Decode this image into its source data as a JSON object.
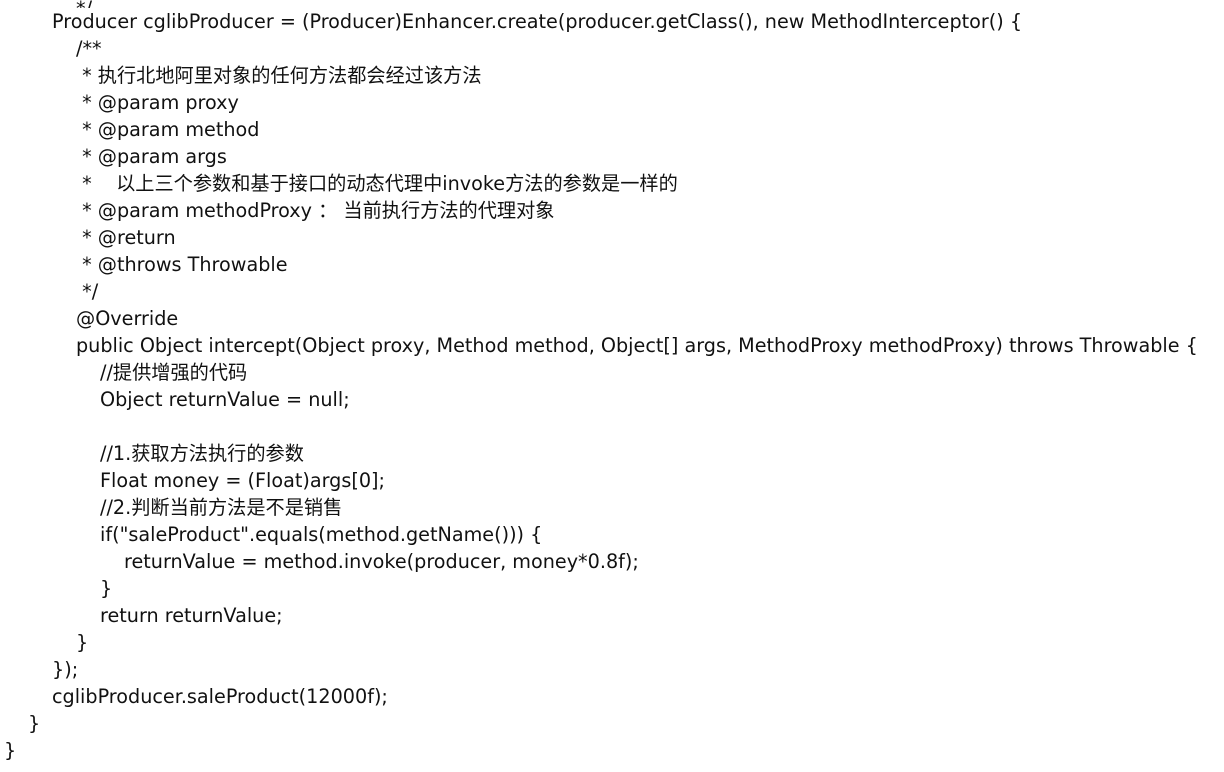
{
  "code": {
    "lines": [
      {
        "indent": 3,
        "text": "*/"
      },
      {
        "indent": 2,
        "text": "Producer cglibProducer = (Producer)Enhancer.create(producer.getClass(), new MethodInterceptor() {"
      },
      {
        "indent": 3,
        "text": "/**"
      },
      {
        "indent": 3,
        "text": " * 执行北地阿里对象的任何方法都会经过该方法"
      },
      {
        "indent": 3,
        "text": " * @param proxy"
      },
      {
        "indent": 3,
        "text": " * @param method"
      },
      {
        "indent": 3,
        "text": " * @param args"
      },
      {
        "indent": 3,
        "text": " *    以上三个参数和基于接口的动态代理中invoke方法的参数是一样的"
      },
      {
        "indent": 3,
        "text": " * @param methodProxy ： 当前执行方法的代理对象"
      },
      {
        "indent": 3,
        "text": " * @return"
      },
      {
        "indent": 3,
        "text": " * @throws Throwable"
      },
      {
        "indent": 3,
        "text": " */"
      },
      {
        "indent": 3,
        "text": "@Override"
      },
      {
        "indent": 3,
        "text": "public Object intercept(Object proxy, Method method, Object[] args, MethodProxy methodProxy) throws Throwable {"
      },
      {
        "indent": 4,
        "text": "//提供增强的代码"
      },
      {
        "indent": 4,
        "text": "Object returnValue = null;"
      },
      {
        "indent": 4,
        "text": ""
      },
      {
        "indent": 4,
        "text": "//1.获取方法执行的参数"
      },
      {
        "indent": 4,
        "text": "Float money = (Float)args[0];"
      },
      {
        "indent": 4,
        "text": "//2.判断当前方法是不是销售"
      },
      {
        "indent": 4,
        "text": "if(\"saleProduct\".equals(method.getName())) {"
      },
      {
        "indent": 5,
        "text": "returnValue = method.invoke(producer, money*0.8f);"
      },
      {
        "indent": 4,
        "text": "}"
      },
      {
        "indent": 4,
        "text": "return returnValue;"
      },
      {
        "indent": 3,
        "text": "}"
      },
      {
        "indent": 2,
        "text": "});"
      },
      {
        "indent": 2,
        "text": "cglibProducer.saleProduct(12000f);"
      },
      {
        "indent": 1,
        "text": "}"
      },
      {
        "indent": 0,
        "text": "}"
      }
    ]
  }
}
